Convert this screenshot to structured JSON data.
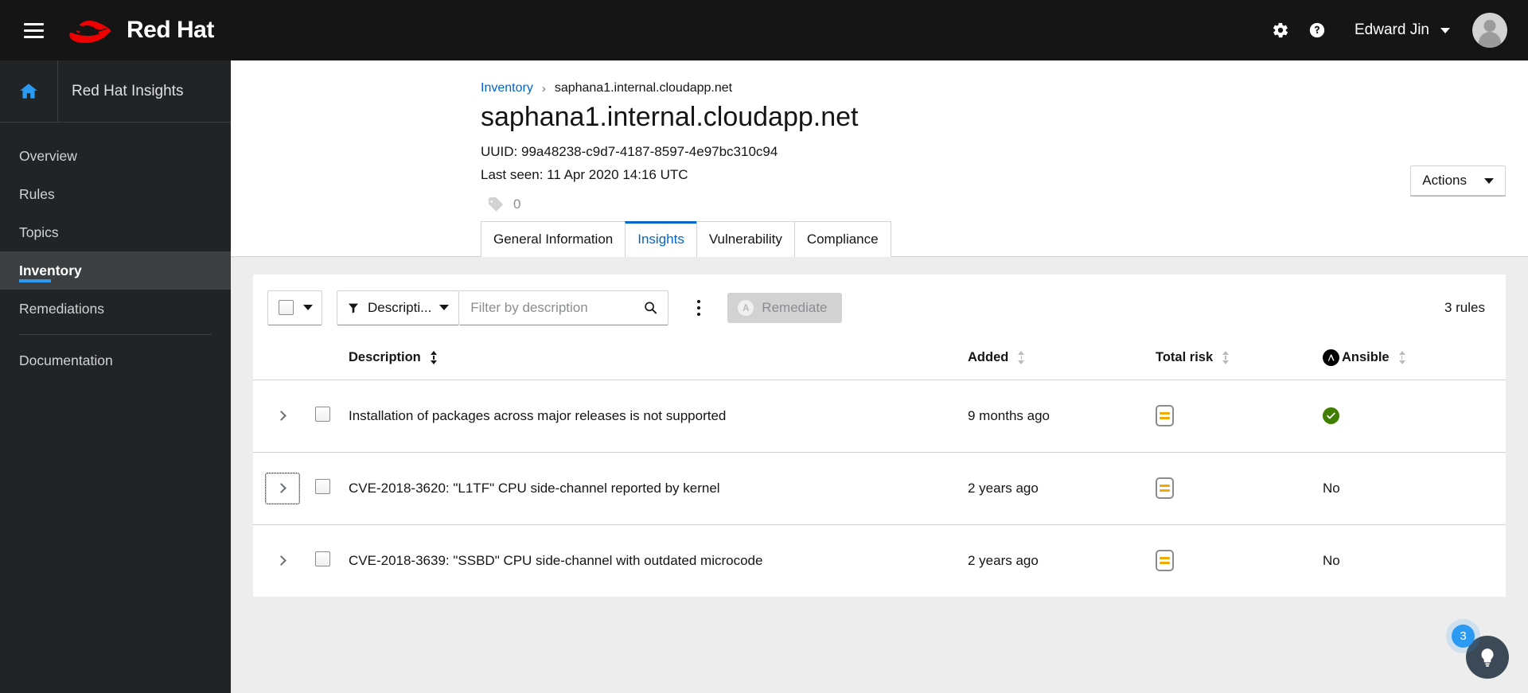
{
  "masthead": {
    "brand_name": "Red Hat",
    "hamburger_name": "global-nav-toggle",
    "settings_label": "Settings",
    "help_label": "Help",
    "user_name": "Edward Jin"
  },
  "sidebar": {
    "app_title": "Red Hat Insights",
    "items": [
      {
        "label": "Overview",
        "active": false
      },
      {
        "label": "Rules",
        "active": false
      },
      {
        "label": "Topics",
        "active": false
      },
      {
        "label": "Inventory",
        "active": true
      },
      {
        "label": "Remediations",
        "active": false
      },
      {
        "label": "Documentation",
        "active": false
      }
    ]
  },
  "breadcrumb": {
    "parent": "Inventory",
    "separator": "›",
    "current": "saphana1.internal.cloudapp.net"
  },
  "header": {
    "title": "saphana1.internal.cloudapp.net",
    "uuid": "UUID: 99a48238-c9d7-4187-8597-4e97bc310c94",
    "last_seen": "Last seen: 11 Apr 2020 14:16 UTC",
    "tag_count": "0",
    "actions_label": "Actions"
  },
  "tabs": [
    {
      "label": "General Information",
      "active": false
    },
    {
      "label": "Insights",
      "active": true
    },
    {
      "label": "Vulnerability",
      "active": false
    },
    {
      "label": "Compliance",
      "active": false
    }
  ],
  "toolbar": {
    "filter_type_label": "Descripti...",
    "search_placeholder": "Filter by description",
    "search_value": "",
    "remediate_label": "Remediate",
    "rules_count": "3 rules"
  },
  "table": {
    "columns": [
      {
        "label": "Description"
      },
      {
        "label": "Added"
      },
      {
        "label": "Total risk"
      },
      {
        "label": "Ansible"
      }
    ],
    "rows": [
      {
        "description": "Installation of packages across major releases is not supported",
        "added": "9 months ago",
        "total_risk": "moderate",
        "ansible": "yes",
        "ansible_text": "",
        "focused": false
      },
      {
        "description": "CVE-2018-3620: \"L1TF\" CPU side-channel reported by kernel",
        "added": "2 years ago",
        "total_risk": "moderate",
        "ansible": "no",
        "ansible_text": "No",
        "focused": true
      },
      {
        "description": "CVE-2018-3639: \"SSBD\" CPU side-channel with outdated microcode",
        "added": "2 years ago",
        "total_risk": "moderate",
        "ansible": "no",
        "ansible_text": "No",
        "focused": false
      }
    ]
  },
  "help_fab": {
    "badge": "3"
  },
  "colors": {
    "brand_red": "#ee0000",
    "masthead_bg": "#151515",
    "sidebar_bg": "#212427",
    "accent_blue": "#2b9af3",
    "link_blue": "#06c",
    "content_bg": "#ededed",
    "risk_orange": "#f0ab00",
    "success_green": "#3f7e00",
    "fab_bg": "#3c4a57"
  }
}
